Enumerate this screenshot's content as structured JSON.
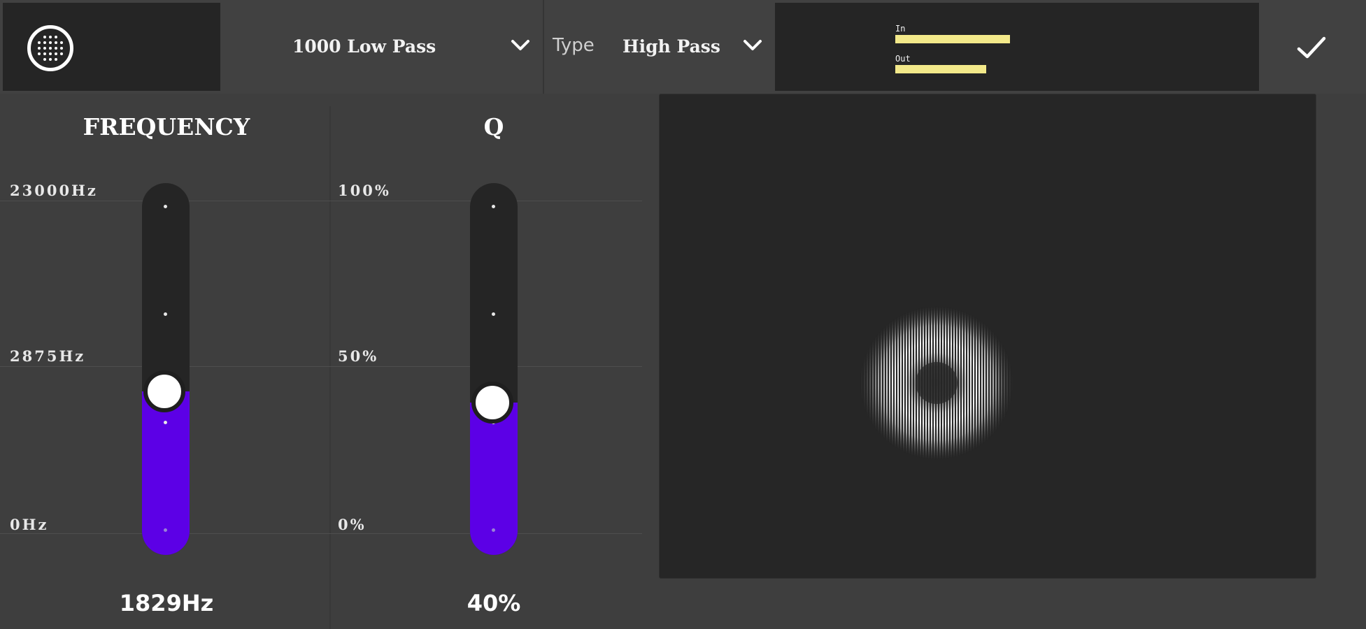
{
  "toolbar": {
    "preset": {
      "value": "1000 Low Pass",
      "icon": "chevron-down-icon"
    },
    "type": {
      "label": "Type",
      "value": "High Pass",
      "icon": "chevron-down-icon"
    },
    "meter": {
      "in_label": "In",
      "out_label": "Out",
      "in_level": 0.82,
      "out_level": 0.65,
      "bar_color": "#f3e98a"
    },
    "confirm_icon": "checkmark-icon",
    "logo_icon": "dot-grid-logo-icon"
  },
  "frequency": {
    "title": "FREQUENCY",
    "ticks": {
      "top": "23000Hz",
      "mid": "2875Hz",
      "bottom": "0Hz"
    },
    "value": "1829Hz",
    "level": 0.44
  },
  "q": {
    "title": "Q",
    "ticks": {
      "top": "100%",
      "mid": "50%",
      "bottom": "0%"
    },
    "value": "40%",
    "level": 0.41
  },
  "colors": {
    "accent": "#5c00e6",
    "background": "#3e3e3e",
    "panel": "#252525",
    "meter": "#f3e98a"
  }
}
